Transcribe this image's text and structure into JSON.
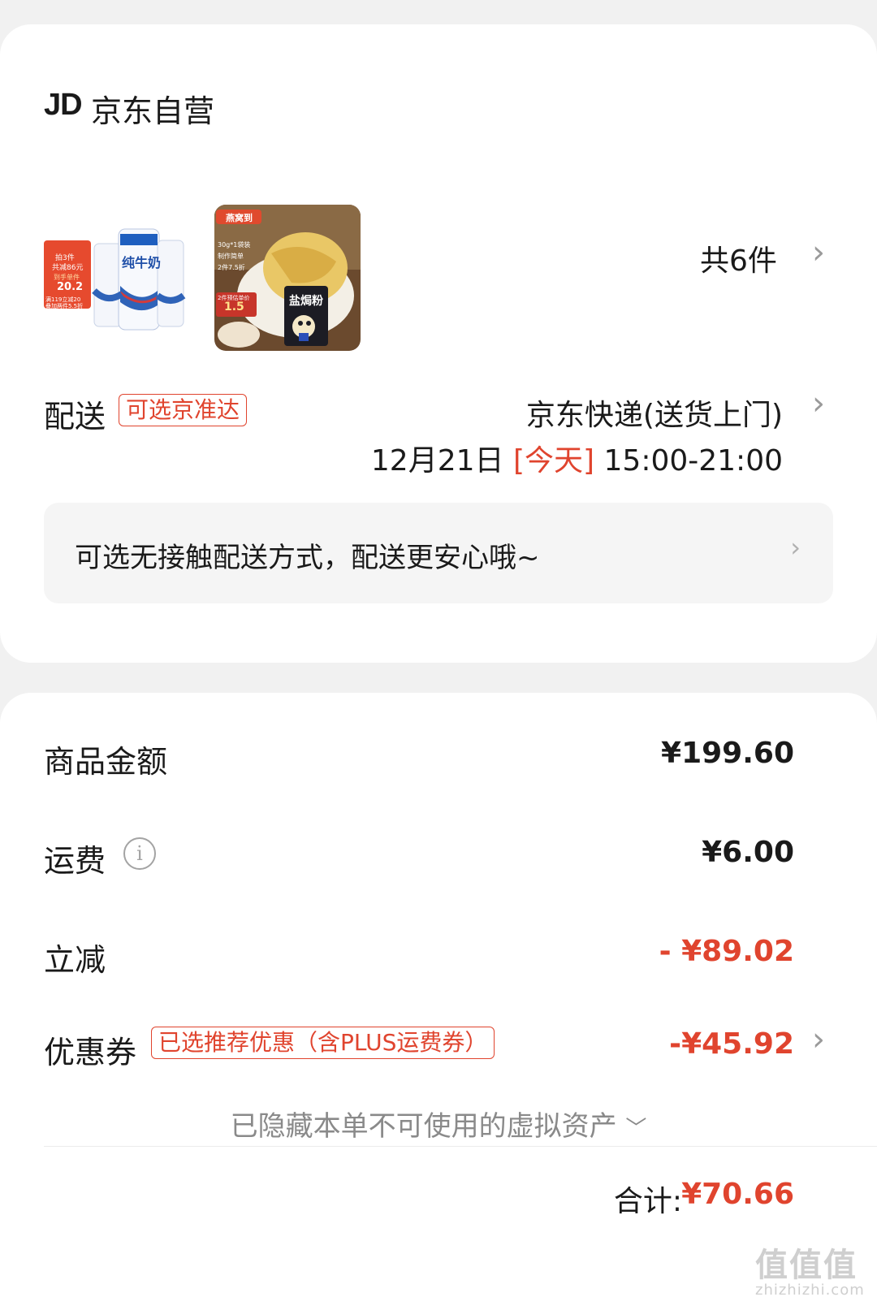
{
  "store": {
    "logo_text": "JD",
    "name": "京东自营"
  },
  "products": {
    "item1": {
      "badge_line1": "拍3件",
      "badge_line2": "共减86元",
      "badge_line3": "到手单件",
      "badge_price": "20.2",
      "badge_line4": "满119立减20",
      "badge_line5": "叠加两件5.5折",
      "carton_title": "纯牛奶"
    },
    "item2": {
      "brand": "燕窝到",
      "line1": "30g*1袋装",
      "line2": "制作简单",
      "line3": "2件7.5折",
      "note": "2件预估单价",
      "price": "1.5",
      "pack_title": "盐焗粉"
    },
    "count_text": "共6件"
  },
  "delivery": {
    "label": "配送",
    "tag": "可选京准达",
    "method": "京东快递(送货上门)",
    "date": "12月21日",
    "today": "[今天]",
    "time": "15:00-21:00",
    "notice": "可选无接触配送方式，配送更安心哦~"
  },
  "pricing": {
    "goods_label": "商品金额",
    "goods_value": "¥199.60",
    "shipping_label": "运费",
    "shipping_value": "¥6.00",
    "discount_label": "立减",
    "discount_value": "- ¥89.02",
    "coupon_label": "优惠券",
    "coupon_tag": "已选推荐优惠（含PLUS运费券）",
    "coupon_value": "-¥45.92",
    "hidden_note": "已隐藏本单不可使用的虚拟资产",
    "total_label": "合计:",
    "total_value": "¥70.66"
  },
  "watermark": {
    "text": "值值值",
    "sub": "zhizhizhi.com"
  },
  "colors": {
    "accent_red": "#e0442e",
    "background": "#f1f1f1",
    "card": "#ffffff"
  }
}
